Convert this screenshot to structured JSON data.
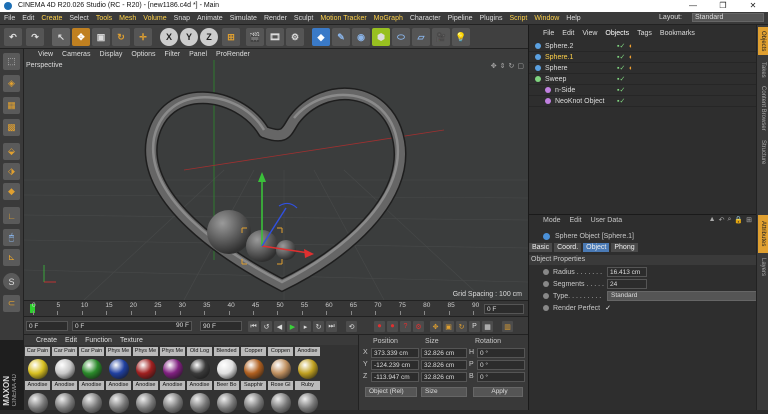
{
  "window": {
    "title": "CINEMA 4D R20.026 Studio (RC - R20) - [new1186.c4d *] - Main",
    "minimize": "—",
    "maximize": "❐",
    "close": "✕"
  },
  "menu": {
    "items": [
      "File",
      "Edit",
      "Create",
      "Select",
      "Tools",
      "Mesh",
      "Volume",
      "Snap",
      "Animate",
      "Simulate",
      "Render",
      "Sculpt",
      "Motion Tracker",
      "MoGraph",
      "Character",
      "Pipeline",
      "Plugins",
      "Script",
      "Window",
      "Help"
    ],
    "highlighted": [
      "Create",
      "Tools",
      "Mesh",
      "Volume",
      "Motion Tracker",
      "MoGraph",
      "Script",
      "Window"
    ],
    "layout_label": "Layout:",
    "layout_value": "Standard"
  },
  "toolbar": {
    "axes": [
      "X",
      "Y",
      "Z"
    ]
  },
  "viewport": {
    "menu": [
      "View",
      "Cameras",
      "Display",
      "Options",
      "Filter",
      "Panel",
      "ProRender"
    ],
    "camera": "Perspective",
    "grid_spacing": "Grid Spacing : 100 cm"
  },
  "timeline": {
    "ticks": [
      "0",
      "5",
      "10",
      "15",
      "20",
      "25",
      "30",
      "35",
      "40",
      "45",
      "50",
      "55",
      "60",
      "65",
      "70",
      "75",
      "80",
      "85",
      "90"
    ],
    "end_frame": "0 F"
  },
  "transport": {
    "start": "0 F",
    "current": "0 F",
    "end1": "90 F",
    "end2": "90 F"
  },
  "materials": {
    "tabs": [
      "Create",
      "Edit",
      "Function",
      "Texture"
    ],
    "row1": [
      {
        "name": "Car Pain",
        "color": "#d8c020"
      },
      {
        "name": "Car Pain",
        "color": "#c8c8c8"
      },
      {
        "name": "Car Pain",
        "color": "#2a8a2a"
      },
      {
        "name": "Phys Me",
        "color": "#2040a0"
      },
      {
        "name": "Phys Me",
        "color": "#a02020"
      },
      {
        "name": "Phys Me",
        "color": "#802080"
      },
      {
        "name": "Old Log",
        "color": "#3a3a3a"
      },
      {
        "name": "Blended",
        "color": "#e0e0e0"
      },
      {
        "name": "Copper",
        "color": "#b06020"
      },
      {
        "name": "Coppen",
        "color": "#c09060"
      },
      {
        "name": "Anodise",
        "color": "#c0a020"
      }
    ],
    "row2": [
      "Anodise",
      "Anodise",
      "Anodise",
      "Anodise",
      "Anodise",
      "Anodise",
      "Anodise",
      "Beer Bo",
      "Sapphir",
      "Rose Gl",
      "Ruby"
    ]
  },
  "coords": {
    "headers": [
      "Position",
      "Size",
      "Rotation"
    ],
    "rows": [
      {
        "axis": "X",
        "pos": "373.339 cm",
        "size": "32.826 cm",
        "rlabel": "H",
        "rot": "0 °"
      },
      {
        "axis": "Y",
        "pos": "-124.239 cm",
        "size": "32.826 cm",
        "rlabel": "P",
        "rot": "0 °"
      },
      {
        "axis": "Z",
        "pos": "-113.947 cm",
        "size": "32.826 cm",
        "rlabel": "B",
        "rot": "0 °"
      }
    ],
    "mode": "Object (Rel)",
    "size_mode": "Size",
    "apply": "Apply"
  },
  "objects": {
    "menu": [
      "File",
      "Edit",
      "View",
      "Objects",
      "Tags",
      "Bookmarks"
    ],
    "items": [
      {
        "name": "Sphere.2",
        "level": 0,
        "selected": false
      },
      {
        "name": "Sphere.1",
        "level": 0,
        "selected": true
      },
      {
        "name": "Sphere",
        "level": 0,
        "selected": false
      },
      {
        "name": "Sweep",
        "level": 0,
        "selected": false
      },
      {
        "name": "n-Side",
        "level": 1,
        "selected": false
      },
      {
        "name": "NeoKnot Object",
        "level": 1,
        "selected": false
      }
    ]
  },
  "attributes": {
    "menu": [
      "Mode",
      "Edit",
      "User Data"
    ],
    "object_title": "Sphere Object [Sphere.1]",
    "tabs": [
      "Basic",
      "Coord.",
      "Object",
      "Phong"
    ],
    "active_tab": "Object",
    "section": "Object Properties",
    "radius_label": "Radius . . . . . . .",
    "radius_value": "16.413 cm",
    "segments_label": "Segments . . . . .",
    "segments_value": "24",
    "type_label": "Type. . . . . . . . .",
    "type_value": "Standard",
    "perfect_label": "Render Perfect",
    "perfect_value": "✓"
  },
  "right_tabs": [
    "Objects",
    "Takes",
    "Content Browser",
    "Structure",
    "Attributes",
    "Layers"
  ],
  "brand": {
    "line1": "MAXON",
    "line2": "CINEMA 4D"
  }
}
